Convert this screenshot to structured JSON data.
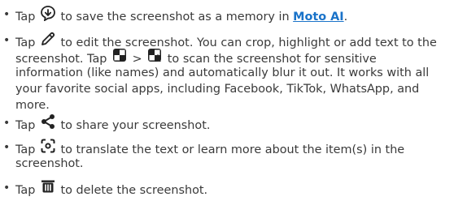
{
  "items": [
    {
      "lines": [
        {
          "pre": "Tap ",
          "icon": "save-to-memory-icon",
          "post": " to save the screenshot as a memory in ",
          "link": "Moto AI",
          "end": "."
        }
      ]
    },
    {
      "lines": [
        {
          "pre": "Tap ",
          "icon": "edit-pencil-icon",
          "post": " to edit the screenshot. You can crop, highlight or add text to the"
        },
        {
          "text": "screenshot. Tap ",
          "icon1": "blur-icon",
          "mid": " > ",
          "icon2": "auto-blur-icon",
          "post": " to scan the screenshot for sensitive"
        },
        {
          "text": "information (like names) and automatically blur it out. It works with all"
        },
        {
          "text": "your favorite social apps, including Facebook, TikTok, WhatsApp, and"
        },
        {
          "text": "more."
        }
      ]
    },
    {
      "lines": [
        {
          "pre": "Tap ",
          "icon": "share-icon",
          "post": " to share your screenshot."
        }
      ]
    },
    {
      "lines": [
        {
          "pre": "Tap ",
          "icon": "lens-scan-icon",
          "post": " to translate the text or learn more about the item(s) in the"
        },
        {
          "text": "screenshot."
        }
      ]
    },
    {
      "lines": [
        {
          "pre": "Tap ",
          "icon": "delete-trash-icon",
          "post": " to delete the screenshot."
        }
      ]
    }
  ],
  "colors": {
    "text": "#3a3a3a",
    "link": "#1a73c9",
    "icon": "#222222"
  }
}
